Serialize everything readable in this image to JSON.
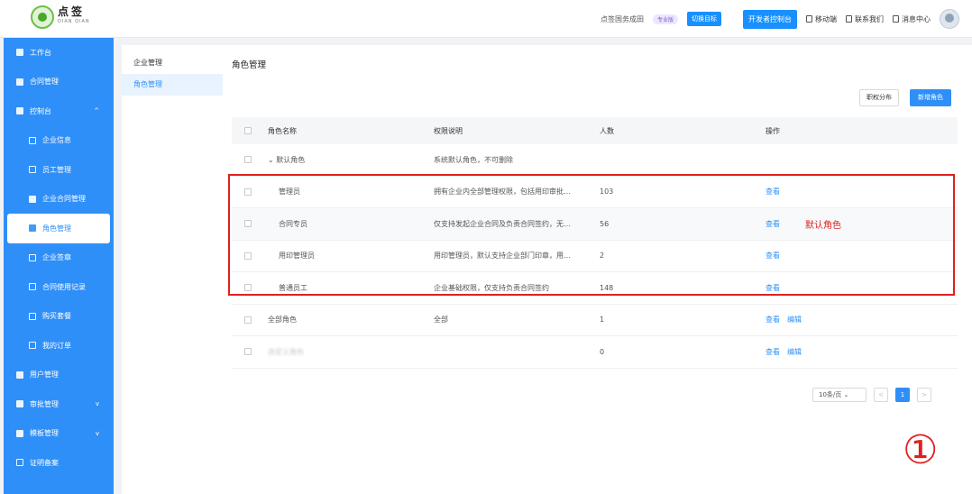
{
  "logo": {
    "cn": "点签",
    "en": "DIAN QIAN"
  },
  "header": {
    "company": "点签国务成田",
    "badge": "专业版",
    "switch_label": "切换目标",
    "open_label": "开发者控制台",
    "links": [
      "移动端",
      "联系我们",
      "消息中心"
    ]
  },
  "sidebar": {
    "items": [
      {
        "label": "工作台",
        "icon": "home-icon"
      },
      {
        "label": "合同管理",
        "icon": "contract-icon"
      },
      {
        "label": "控制台",
        "icon": "chart-icon",
        "expand": "^"
      },
      {
        "label": "企业信息",
        "icon": "building-icon"
      },
      {
        "label": "员工管理",
        "icon": "user-icon"
      },
      {
        "label": "企业合同管理",
        "icon": "file-icon"
      },
      {
        "label": "角色管理",
        "icon": "org-icon"
      },
      {
        "label": "企业签章",
        "icon": "stamp-icon"
      },
      {
        "label": "合同使用记录",
        "icon": "record-icon"
      },
      {
        "label": "购买套餐",
        "icon": "cart-icon"
      },
      {
        "label": "我的订单",
        "icon": "order-icon"
      },
      {
        "label": "用户管理",
        "icon": "person-icon"
      },
      {
        "label": "审批管理",
        "icon": "approve-icon",
        "expand": "v"
      },
      {
        "label": "模板管理",
        "icon": "template-icon",
        "expand": "v"
      },
      {
        "label": "证明备案",
        "icon": "doc-icon"
      }
    ]
  },
  "subnav": {
    "items": [
      "企业管理",
      "角色管理"
    ]
  },
  "content": {
    "title": "角色管理",
    "btn_ghost": "职权分布",
    "btn_primary": "新增角色",
    "columns": [
      "角色名称",
      "权限说明",
      "人数",
      "操作"
    ],
    "group": {
      "name": "默认角色",
      "desc": "系统默认角色，不可删除"
    },
    "rows": [
      {
        "name": "管理员",
        "desc": "拥有企业内全部管理权限，包括用印审批…",
        "count": "103",
        "actions": [
          "查看"
        ]
      },
      {
        "name": "合同专员",
        "desc": "仅支持发起企业合同及负责合同签约，无…",
        "count": "56",
        "actions": [
          "查看"
        ]
      },
      {
        "name": "用印管理员",
        "desc": "用印管理员，默认支持企业部门印章，用…",
        "count": "2",
        "actions": [
          "查看"
        ]
      },
      {
        "name": "普通员工",
        "desc": "企业基础权限，仅支持负责合同签约",
        "count": "148",
        "actions": [
          "查看"
        ]
      }
    ],
    "extra_rows": [
      {
        "name": "全部角色",
        "desc": "全部",
        "count": "1",
        "actions": [
          "查看",
          "编辑"
        ]
      },
      {
        "name": "自定义角色",
        "desc": "",
        "count": "0",
        "actions": [
          "查看",
          "编辑"
        ]
      }
    ],
    "annotation": "默认角色",
    "pager": {
      "size": "10条/页",
      "page": "1",
      "prev": "<",
      "next": ">"
    },
    "marker": "①"
  }
}
